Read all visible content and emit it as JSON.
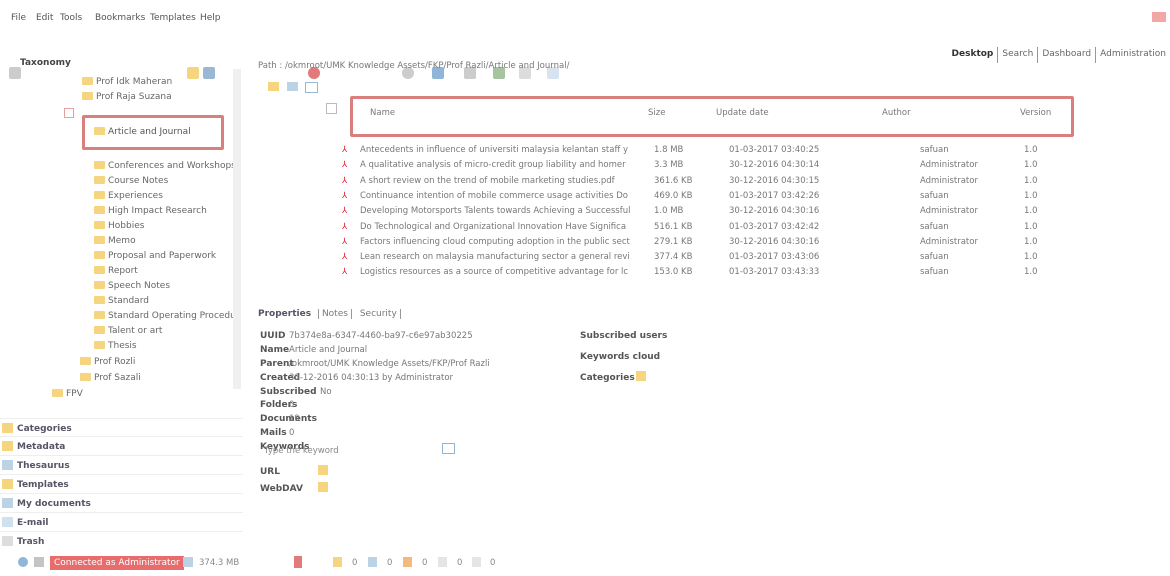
{
  "menu": [
    "File",
    "Edit",
    "Tools",
    "Bookmarks",
    "Templates",
    "Help"
  ],
  "tabs": [
    "Desktop",
    "Search",
    "Dashboard",
    "Administration"
  ],
  "path": "Path : /okmroot/UMK Knowledge Assets/FKP/Prof Razli/Article and Journal/",
  "tree": {
    "title": "Taxonomy",
    "items": [
      "Prof Idk Maheran",
      "Prof Raja Suzana",
      "Article and Journal",
      "Conferences and Workshops",
      "Course Notes",
      "Experiences",
      "High Impact Research",
      "Hobbies",
      "Memo",
      "Proposal and Paperwork",
      "Report",
      "Speech Notes",
      "Standard",
      "Standard Operating Procedur",
      "Talent or art",
      "Thesis",
      "Prof Rozli",
      "Prof Sazali",
      "FPV"
    ]
  },
  "sections": [
    "Categories",
    "Metadata",
    "Thesaurus",
    "Templates",
    "My documents",
    "E-mail",
    "Trash"
  ],
  "table": {
    "headers": [
      "Name",
      "Size",
      "Update date",
      "Author",
      "Version"
    ],
    "rows": [
      [
        "Antecedents in influence of universiti malaysia kelantan staff y",
        "1.8 MB",
        "01-03-2017 03:40:25",
        "safuan",
        "1.0"
      ],
      [
        "A qualitative analysis of micro-credit group liability and homer",
        "3.3 MB",
        "30-12-2016 04:30:14",
        "Administrator",
        "1.0"
      ],
      [
        "A short review on the trend of mobile marketing studies.pdf",
        "361.6 KB",
        "30-12-2016 04:30:15",
        "Administrator",
        "1.0"
      ],
      [
        "Continuance intention of mobile commerce usage activities Do",
        "469.0 KB",
        "01-03-2017 03:42:26",
        "safuan",
        "1.0"
      ],
      [
        "Developing Motorsports Talents towards Achieving a Successful",
        "1.0 MB",
        "30-12-2016 04:30:16",
        "Administrator",
        "1.0"
      ],
      [
        "Do Technological and Organizational Innovation Have Significa",
        "516.1 KB",
        "01-03-2017 03:42:42",
        "safuan",
        "1.0"
      ],
      [
        "Factors influencing cloud computing adoption in the public sect",
        "279.1 KB",
        "30-12-2016 04:30:16",
        "Administrator",
        "1.0"
      ],
      [
        "Lean research on malaysia manufacturing sector a general revi",
        "377.4 KB",
        "01-03-2017 03:43:06",
        "safuan",
        "1.0"
      ],
      [
        "Logistics resources as a source of competitive advantage for lc",
        "153.0 KB",
        "01-03-2017 03:43:33",
        "safuan",
        "1.0"
      ]
    ]
  },
  "props": {
    "tabs": [
      "Properties",
      "Notes",
      "Security"
    ],
    "labels": [
      "UUID",
      "Name",
      "Parent",
      "Created",
      "Subscribed",
      "Folders",
      "Documents",
      "Mails",
      "Keywords"
    ],
    "values": [
      "7b374e8a-6347-4460-ba97-c6e97ab30225",
      "Article and Journal",
      "/okmroot/UMK Knowledge Assets/FKP/Prof Razli",
      "30-12-2016 04:30:13 by Administrator",
      "No",
      "0",
      "19",
      "0"
    ],
    "keyword_placeholder": "Type the keyword",
    "url_label": "URL",
    "webdav_label": "WebDAV",
    "right": [
      "Subscribed users",
      "Keywords cloud",
      "Categories"
    ]
  },
  "status": {
    "connected": "Connected as Administrator",
    "size": "374.3 MB",
    "counts": [
      "0",
      "0",
      "0",
      "0",
      "0"
    ]
  }
}
